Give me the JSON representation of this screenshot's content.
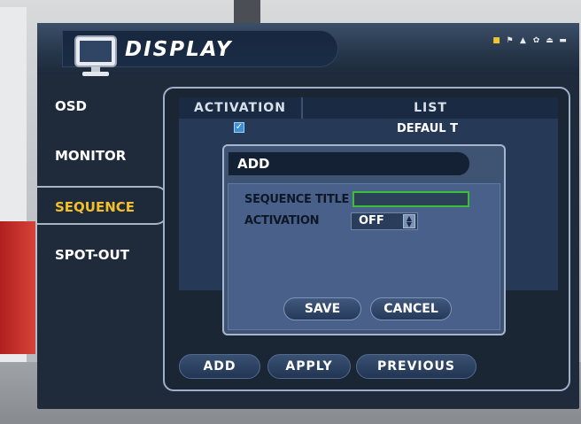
{
  "header": {
    "title": "DISPLAY",
    "status_icons": [
      "monitor-icon",
      "flag-icon",
      "person-icon",
      "gear-icon",
      "eject-icon",
      "network-icon"
    ],
    "accent_color": "#f2c530"
  },
  "menu": {
    "items": [
      {
        "label": "OSD"
      },
      {
        "label": "MONITOR"
      },
      {
        "label": "SEQUENCE"
      },
      {
        "label": "SPOT-OUT"
      }
    ],
    "selected_index": 2,
    "selected_color": "#f2c02a"
  },
  "list": {
    "columns": [
      "ACTIVATION",
      "LIST"
    ],
    "rows": [
      {
        "activation_checked": true,
        "name": "DEFAUL T"
      }
    ]
  },
  "footer_buttons": {
    "add_label": "ADD",
    "apply_label": "APPLY",
    "previous_label": "PREVIOUS"
  },
  "dialog": {
    "title": "ADD",
    "sequence_title_label": "SEQUENCE TITLE",
    "sequence_title_value": "",
    "activation_label": "ACTIVATION",
    "activation_value": "OFF",
    "save_label": "SAVE",
    "cancel_label": "CANCEL",
    "focus_color": "#3ebd38"
  }
}
